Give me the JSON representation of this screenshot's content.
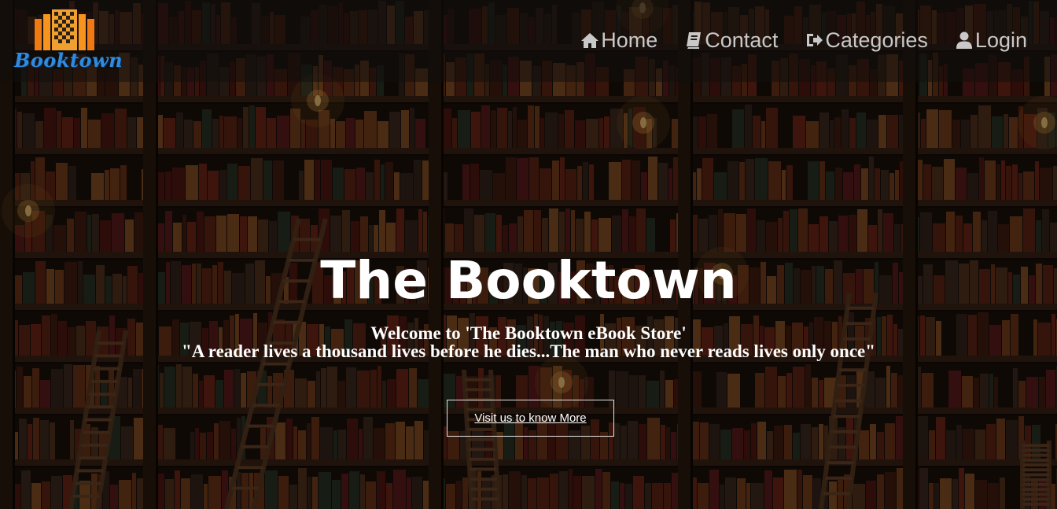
{
  "brand": {
    "name": "Booktown",
    "logo_icon": "books-logo-icon"
  },
  "nav": {
    "items": [
      {
        "label": "Home",
        "icon": "home-icon"
      },
      {
        "label": "Contact",
        "icon": "book-icon"
      },
      {
        "label": "Categories",
        "icon": "sign-out-icon"
      },
      {
        "label": "Login",
        "icon": "user-icon"
      }
    ]
  },
  "hero": {
    "title": "The Booktown",
    "welcome": "Welcome to 'The Booktown eBook Store'",
    "quote": "\"A reader lives a thousand lives before he dies...The man who never reads lives only once\"",
    "cta_label": "Visit us to know More"
  },
  "colors": {
    "logo_orange": "#f07a12",
    "logo_blue": "#2f8be0",
    "nav_text": "#c9c9c9",
    "hero_text": "#ffffff"
  }
}
